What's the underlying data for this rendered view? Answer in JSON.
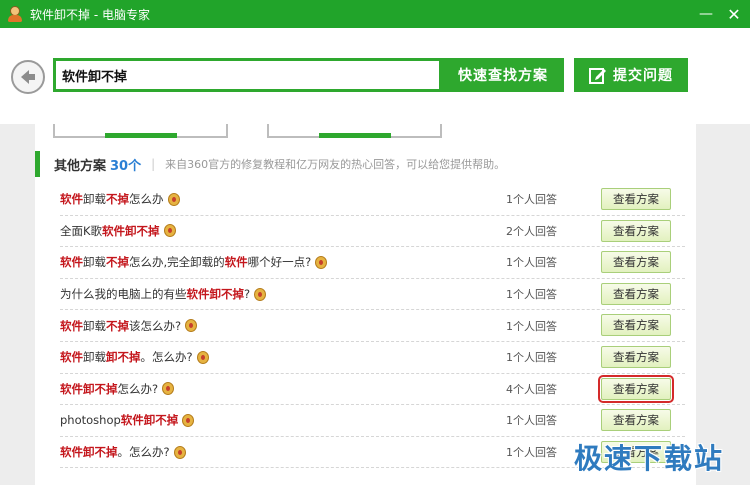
{
  "window": {
    "title": "软件卸不掉 - 电脑专家",
    "minimize_glyph": "—",
    "close_glyph": "✕"
  },
  "header": {
    "search_value": "软件卸不掉",
    "search_button_label": "快速查找方案",
    "submit_button_label": "提交问题"
  },
  "section": {
    "title": "其他方案",
    "count": "30个",
    "separator": "|",
    "description": "来自360官方的修复教程和亿万网友的热心回答，可以给您提供帮助。"
  },
  "results": [
    {
      "parts": [
        [
          "软件",
          true
        ],
        [
          "卸载",
          false
        ],
        [
          "不掉",
          true
        ],
        [
          "怎么办",
          false
        ]
      ],
      "answers": "1个人回答",
      "button": "查看方案"
    },
    {
      "parts": [
        [
          "全面K歌",
          false
        ],
        [
          "软件卸不掉",
          true
        ]
      ],
      "answers": "2个人回答",
      "button": "查看方案"
    },
    {
      "parts": [
        [
          "软件",
          true
        ],
        [
          "卸载",
          false
        ],
        [
          "不掉",
          true
        ],
        [
          "怎么办,完全卸载的",
          false
        ],
        [
          "软件",
          true
        ],
        [
          "哪个好一点?",
          false
        ]
      ],
      "answers": "1个人回答",
      "button": "查看方案"
    },
    {
      "parts": [
        [
          "为什么我的电脑上的有些",
          false
        ],
        [
          "软件卸不掉",
          true
        ],
        [
          "?",
          false
        ]
      ],
      "answers": "1个人回答",
      "button": "查看方案"
    },
    {
      "parts": [
        [
          "软件",
          true
        ],
        [
          "卸载",
          false
        ],
        [
          "不掉",
          true
        ],
        [
          "该怎么办?",
          false
        ]
      ],
      "answers": "1个人回答",
      "button": "查看方案"
    },
    {
      "parts": [
        [
          "软件",
          true
        ],
        [
          "卸载",
          false
        ],
        [
          "卸不掉",
          true
        ],
        [
          "。怎么办?",
          false
        ]
      ],
      "answers": "1个人回答",
      "button": "查看方案"
    },
    {
      "parts": [
        [
          "软件卸不掉",
          true
        ],
        [
          "怎么办?",
          false
        ]
      ],
      "answers": "4个人回答",
      "button": "查看方案",
      "selected": true
    },
    {
      "parts": [
        [
          "photoshop",
          false
        ],
        [
          "软件卸不掉",
          true
        ]
      ],
      "answers": "1个人回答",
      "button": "查看方案"
    },
    {
      "parts": [
        [
          "软件卸不掉",
          true
        ],
        [
          "。怎么办?",
          false
        ]
      ],
      "answers": "1个人回答",
      "button": "查看方案"
    }
  ],
  "watermark": "极速下载站",
  "colors": {
    "brand_green": "#21a42a",
    "highlight_red": "#c4161c",
    "count_blue": "#2a7fd4",
    "selection_outline": "#d42a2a"
  },
  "icons": {
    "back": "arrow-left-icon",
    "submit": "edit-icon",
    "medal": "medal-icon",
    "app": "expert-avatar-icon"
  }
}
